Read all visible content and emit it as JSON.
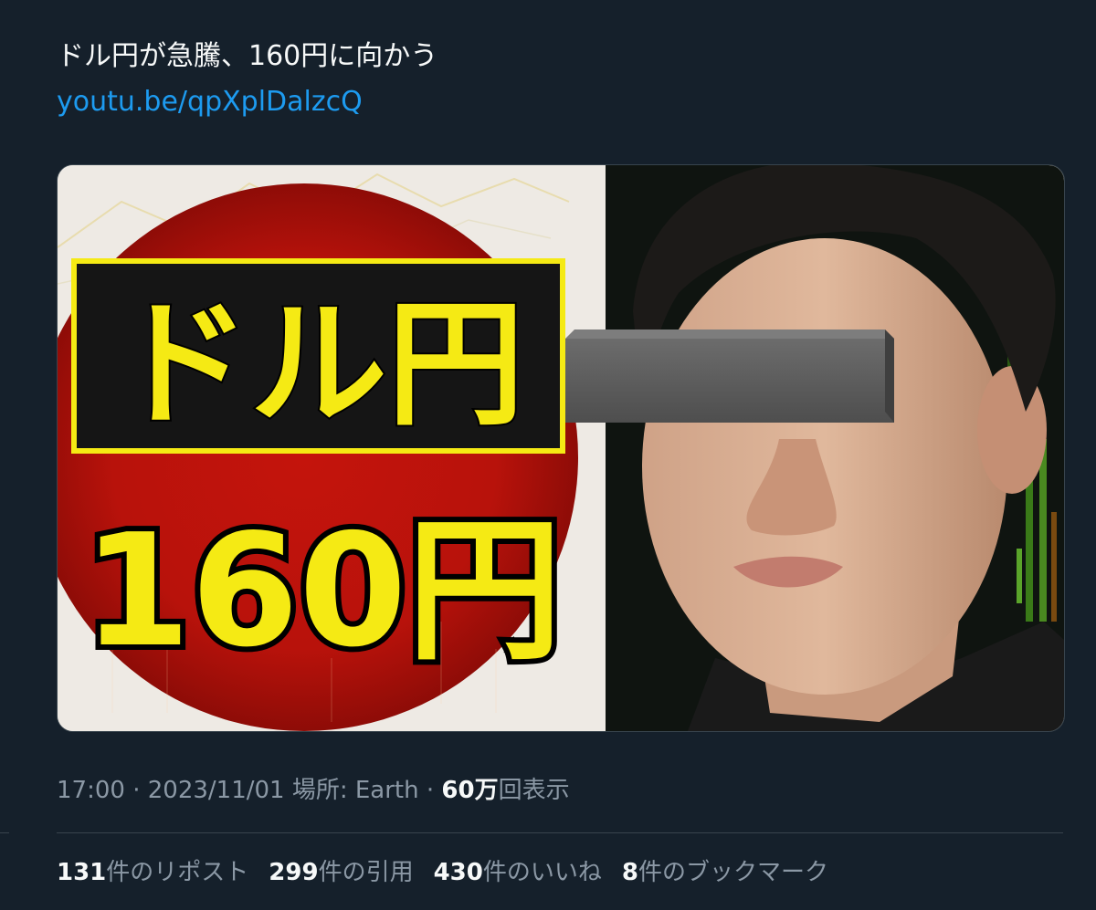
{
  "tweet": {
    "text": "ドル円が急騰、160円に向かう",
    "link": "youtu.be/qpXplDalzcQ"
  },
  "thumbnail": {
    "headline": "ドル円",
    "subheadline": "160円"
  },
  "meta": {
    "time": "17:00",
    "date": "2023/11/01",
    "location_label": "場所: Earth",
    "views_count": "60万",
    "views_label": "回表示",
    "separator": "·"
  },
  "stats": [
    {
      "count": "131",
      "label": "件のリポスト"
    },
    {
      "count": "299",
      "label": "件の引用"
    },
    {
      "count": "430",
      "label": "件のいいね"
    },
    {
      "count": "8",
      "label": "件のブックマーク"
    }
  ],
  "colors": {
    "background": "#15202b",
    "link": "#1d9bf0",
    "secondary_text": "#8b98a5",
    "headline_yellow": "#f5ea14",
    "flag_red": "#c8140c"
  }
}
